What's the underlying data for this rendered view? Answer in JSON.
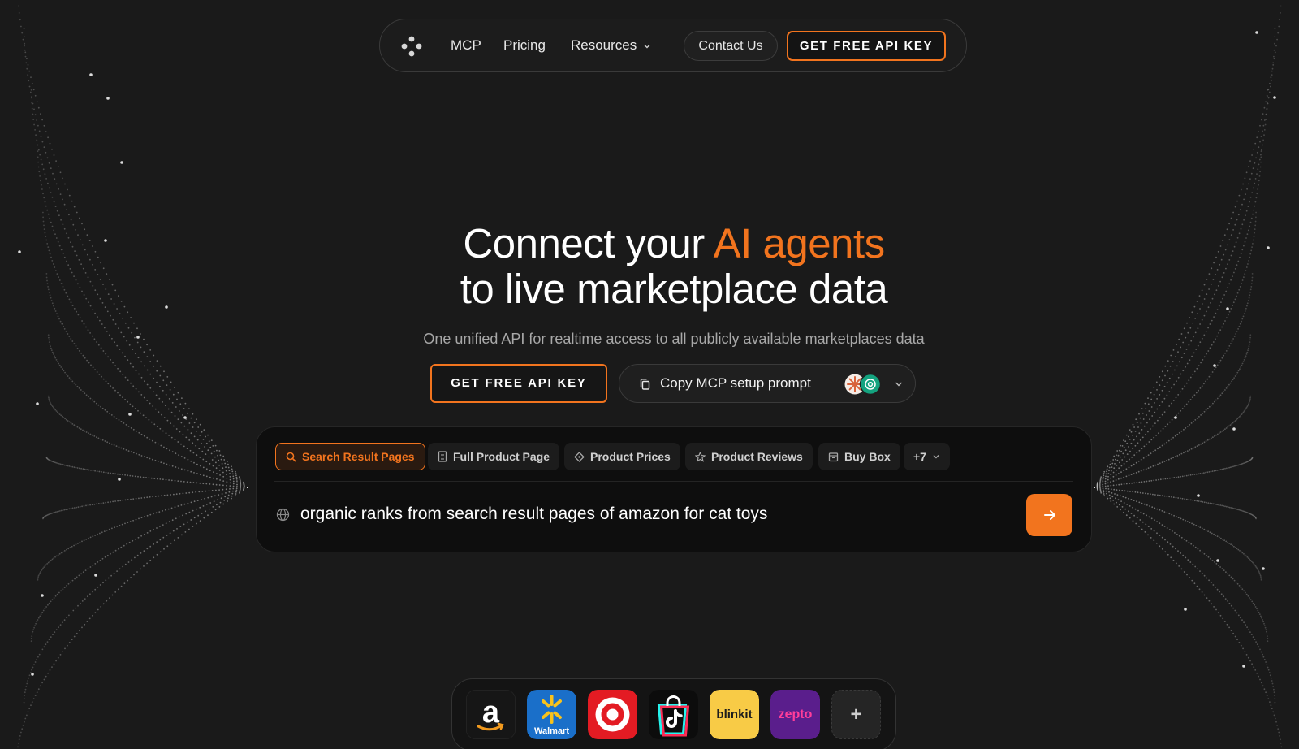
{
  "nav": {
    "links": [
      "MCP",
      "Pricing",
      "Resources"
    ],
    "contact_label": "Contact Us",
    "cta_label": "GET FREE API KEY"
  },
  "hero": {
    "title_line1_prefix": "Connect your ",
    "title_line1_accent": "AI agents",
    "title_line2": "to live marketplace data",
    "subtitle": "One unified API for realtime access to all publicly available marketplaces data",
    "primary_cta": "GET FREE API KEY",
    "copy_cta": "Copy MCP setup prompt"
  },
  "search": {
    "chips": [
      {
        "label": "Search Result Pages",
        "icon": "search-icon",
        "active": true
      },
      {
        "label": "Full Product Page",
        "icon": "document-icon",
        "active": false
      },
      {
        "label": "Product Prices",
        "icon": "tag-icon",
        "active": false
      },
      {
        "label": "Product Reviews",
        "icon": "star-icon",
        "active": false
      },
      {
        "label": "Buy Box",
        "icon": "box-icon",
        "active": false
      },
      {
        "label": "+7",
        "icon": "chevron-down-icon",
        "active": false
      }
    ],
    "query": "organic ranks from search result pages of amazon for cat toys"
  },
  "marketplaces": [
    {
      "name": "amazon",
      "label": "a"
    },
    {
      "name": "walmart",
      "label": "Walmart"
    },
    {
      "name": "target",
      "label": ""
    },
    {
      "name": "tiktok-shop",
      "label": ""
    },
    {
      "name": "blinkit",
      "label": "blinkit"
    },
    {
      "name": "zepto",
      "label": "zepto"
    },
    {
      "name": "more",
      "label": "+"
    }
  ],
  "colors": {
    "accent": "#f2741e",
    "background": "#1a1a1a"
  }
}
